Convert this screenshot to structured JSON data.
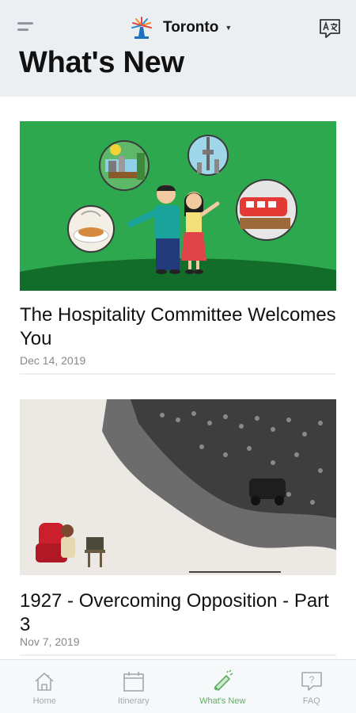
{
  "header": {
    "city": "Toronto",
    "page_title": "What's New"
  },
  "feed": {
    "items": [
      {
        "title": "The Hospitality Committee Welcomes You",
        "date": "Dec 14, 2019"
      },
      {
        "title": "1927 - Overcoming Opposition - Part 3",
        "date": "Nov 7, 2019"
      }
    ]
  },
  "tabbar": {
    "tabs": [
      {
        "label": "Home",
        "icon": "home-icon"
      },
      {
        "label": "Itinerary",
        "icon": "calendar-icon"
      },
      {
        "label": "What's New",
        "icon": "megaphone-icon",
        "active": true
      },
      {
        "label": "FAQ",
        "icon": "question-bubble-icon"
      }
    ],
    "accent_color": "#5bb05f",
    "inactive_color": "#a4a8ac"
  },
  "colors": {
    "header_bg": "#eceff2",
    "card1_bg": "#2ea84f"
  }
}
